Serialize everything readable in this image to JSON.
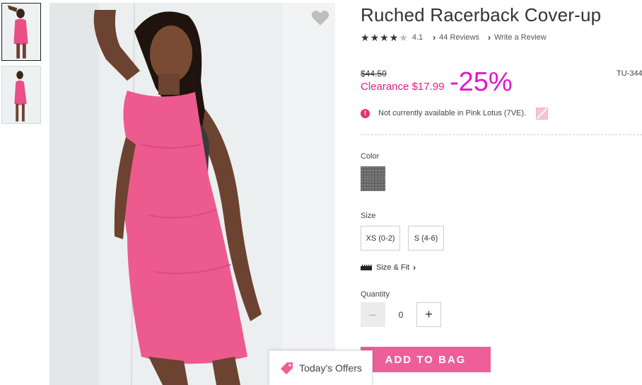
{
  "product": {
    "title": "Ruched Racerback Cover-up",
    "rating": 4.1,
    "rating_text": "4.1",
    "reviews_link": "44 Reviews",
    "write_review_link": "Write a Review",
    "original_price": "$44.50",
    "sale_price": "Clearance $17.99",
    "discount": "-25%",
    "sku": "TU-344",
    "availability_notice": "Not currently available in Pink Lotus (7VE)."
  },
  "options": {
    "color_label": "Color",
    "size_label": "Size",
    "sizes": [
      "XS (0-2)",
      "S (4-6)"
    ],
    "size_fit_link": "Size & Fit",
    "quantity_label": "Quantity",
    "quantity": "0",
    "minus": "–",
    "plus": "+"
  },
  "actions": {
    "add_to_bag": "ADD TO BAG",
    "todays_offers": "Today's Offers"
  },
  "icons": {
    "alert": "!",
    "chevron": "›"
  },
  "colors": {
    "accent_pink": "#ee5f9a",
    "clearance_pink": "#e11e85",
    "discount_magenta": "#e016d0",
    "alert_red": "#e2336b",
    "swatch_heather_gray": "#6a6a6a"
  }
}
